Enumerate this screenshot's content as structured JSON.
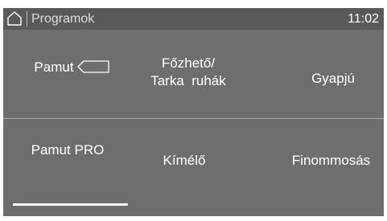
{
  "header": {
    "title": "Programok",
    "time": "11:02",
    "home_icon": "home-icon"
  },
  "programs": {
    "row1": {
      "pamut": "Pamut",
      "fozheto_line1": "Főzhető/",
      "fozheto_line2": "Tarka  ruhák",
      "gyapju": "Gyapjú"
    },
    "row2": {
      "pamut_pro": "Pamut PRO",
      "kimelo": "Kímélő",
      "finommosas": "Finommosás"
    },
    "pamut_icon": "tag-outline-icon"
  },
  "page_indicator": {
    "current_page": 1,
    "fill_fraction": 0.3
  },
  "colors": {
    "panel": "#6e6e6e",
    "header": "#5a5a5a",
    "text": "#ffffff"
  }
}
